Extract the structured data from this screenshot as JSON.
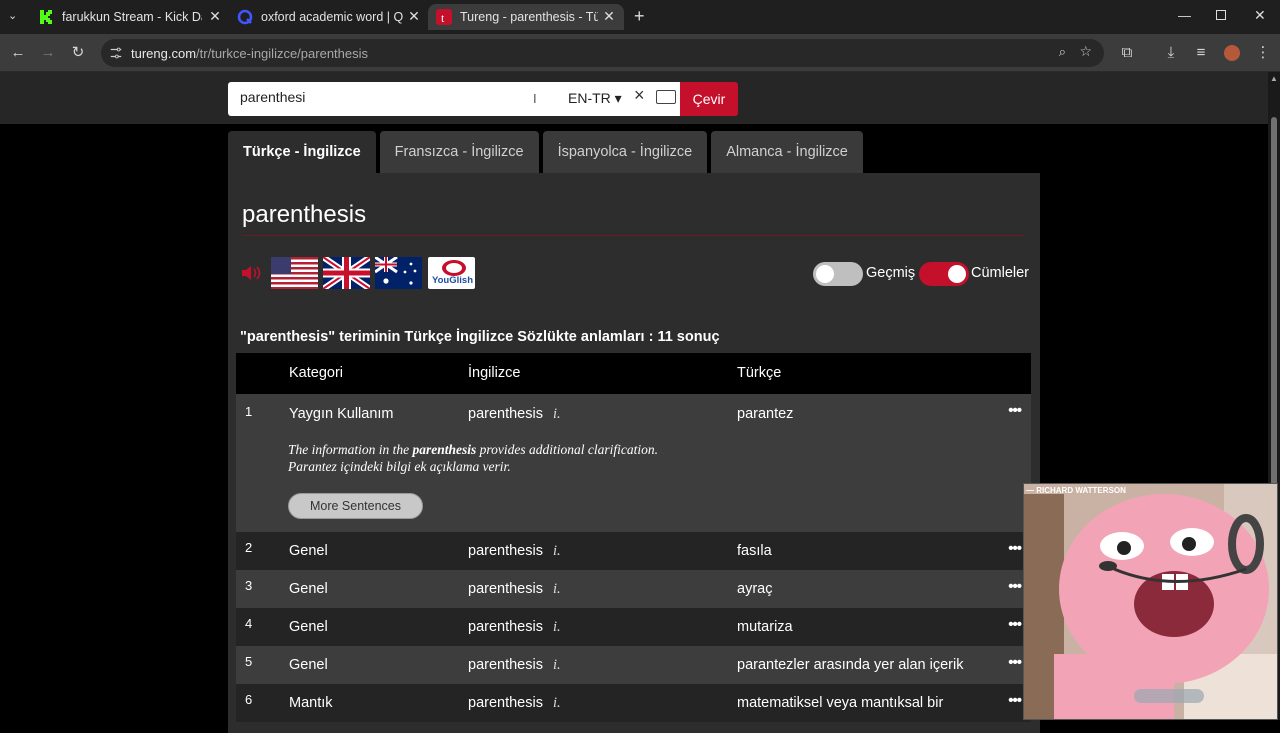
{
  "browser": {
    "tabs": [
      {
        "title": "farukkun Stream - Kick Dashboard",
        "favicon_color": "#53fc18"
      },
      {
        "title": "oxford academic word | Quizlet",
        "favicon_color": "#4255ff"
      },
      {
        "title": "Tureng - parenthesis - Türkçe İngilizce",
        "favicon_color": "#c4102b"
      }
    ],
    "new_tab": "+",
    "url_host": "tureng.com",
    "url_path": "/tr/turkce-ingilizce/parenthesis"
  },
  "search": {
    "value": "parenthesi",
    "lang": "EN-TR ▾",
    "clear": "×",
    "button": "Çevir"
  },
  "lang_tabs": [
    {
      "label": "Türkçe - İngilizce",
      "active": true
    },
    {
      "label": "Fransızca - İngilizce"
    },
    {
      "label": "İspanyolca - İngilizce"
    },
    {
      "label": "Almanca - İngilizce"
    }
  ],
  "entry": {
    "word": "parenthesis",
    "youglish_label": "YouGlish"
  },
  "toggles": {
    "history_label": "Geçmiş",
    "history_on": false,
    "sentences_label": "Cümleler",
    "sentences_on": true
  },
  "result_title": "\"parenthesis\" teriminin Türkçe İngilizce Sözlükte anlamları : 11 sonuç",
  "table": {
    "headers": {
      "category": "Kategori",
      "english": "İngilizce",
      "turkish": "Türkçe"
    },
    "rows": [
      {
        "num": "1",
        "category": "Yaygın Kullanım",
        "english": "parenthesis",
        "pos": "i.",
        "turkish": "parantez"
      },
      {
        "num": "2",
        "category": "Genel",
        "english": "parenthesis",
        "pos": "i.",
        "turkish": "fasıla"
      },
      {
        "num": "3",
        "category": "Genel",
        "english": "parenthesis",
        "pos": "i.",
        "turkish": "ayraç"
      },
      {
        "num": "4",
        "category": "Genel",
        "english": "parenthesis",
        "pos": "i.",
        "turkish": "mutariza"
      },
      {
        "num": "5",
        "category": "Genel",
        "english": "parenthesis",
        "pos": "i.",
        "turkish": "parantezler arasında yer alan içerik"
      },
      {
        "num": "6",
        "category": "Mantık",
        "english": "parenthesis",
        "pos": "i.",
        "turkish": "matematiksel veya mantıksal bir"
      }
    ],
    "sentence": {
      "en_before": "The information in the ",
      "en_bold": "parenthesis",
      "en_after": " provides additional clarification.",
      "tr": "Parantez içindeki bilgi ek açıklama verir.",
      "more_button": "More Sentences"
    },
    "row_menu": "•••"
  },
  "webcam": {
    "label": "— RICHARD WATTERSON"
  },
  "colors": {
    "accent": "#c4102b",
    "card": "#2d2d2d",
    "row_light": "#3d3d3d",
    "row_dark": "#242424"
  }
}
